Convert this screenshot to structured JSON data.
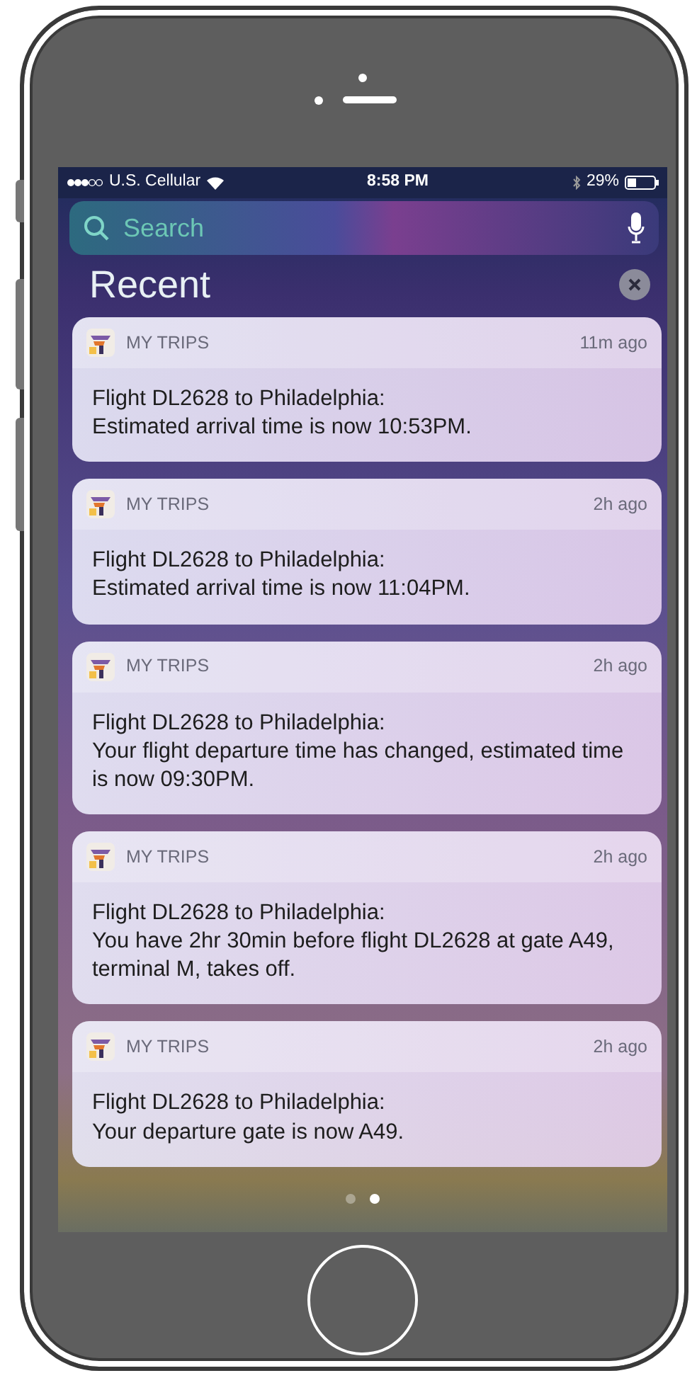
{
  "status_bar": {
    "carrier": "U.S. Cellular",
    "time": "8:58 PM",
    "battery": "29%"
  },
  "search": {
    "placeholder": "Search"
  },
  "section": {
    "title": "Recent"
  },
  "notifications": [
    {
      "app": "MY TRIPS",
      "time": "11m ago",
      "title": "Flight DL2628 to Philadelphia:",
      "body": "Estimated arrival time is now 10:53PM."
    },
    {
      "app": "MY TRIPS",
      "time": "2h ago",
      "title": "Flight DL2628 to Philadelphia:",
      "body": "Estimated arrival time is now 11:04PM."
    },
    {
      "app": "MY TRIPS",
      "time": "2h ago",
      "title": "Flight DL2628 to Philadelphia:",
      "body": "Your flight departure time has changed, estimated time is now 09:30PM."
    },
    {
      "app": "MY TRIPS",
      "time": "2h ago",
      "title": "Flight DL2628 to Philadelphia:",
      "body": "You have 2hr 30min before flight DL2628 at gate A49, terminal M, takes off."
    },
    {
      "app": "MY TRIPS",
      "time": "2h ago",
      "title": "Flight DL2628 to Philadelphia:",
      "body": "Your departure gate is now A49."
    }
  ],
  "pages": [
    {
      "selected": false
    },
    {
      "selected": true
    }
  ]
}
